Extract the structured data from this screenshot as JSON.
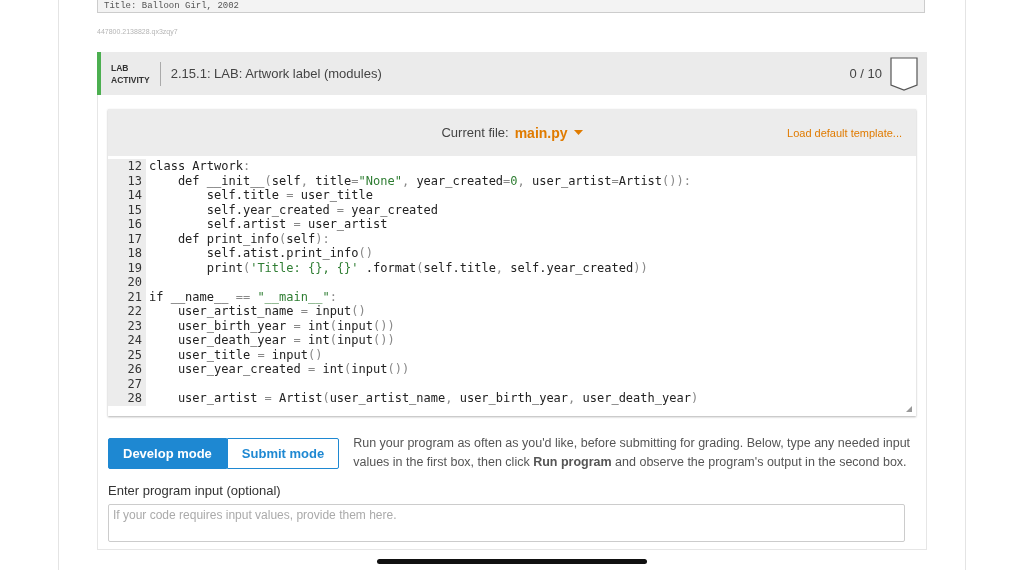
{
  "previous_output": {
    "text": "Title: Balloon Girl, 2002"
  },
  "activity_id": "447800.2138828.qx3zqy7",
  "lab": {
    "badge": [
      "LAB",
      "ACTIVITY"
    ],
    "title": "2.15.1: LAB: Artwork label (modules)",
    "score": "0 / 10"
  },
  "editor": {
    "file_label": "Current file:",
    "file_name": "main.py",
    "template_link": "Load default template...",
    "lines": [
      {
        "number": "12",
        "code": "class Artwork:"
      },
      {
        "number": "13",
        "code": "    def __init__(self, title=\"None\", year_created=0, user_artist=Artist()):"
      },
      {
        "number": "14",
        "code": "        self.title = user_title"
      },
      {
        "number": "15",
        "code": "        self.year_created = year_created"
      },
      {
        "number": "16",
        "code": "        self.artist = user_artist"
      },
      {
        "number": "17",
        "code": "    def print_info(self):"
      },
      {
        "number": "18",
        "code": "        self.atist.print_info()"
      },
      {
        "number": "19",
        "code": "        print('Title: {}, {}' .format(self.title, self.year_created))"
      },
      {
        "number": "20"
      },
      {
        "number": "21",
        "code": "if __name__ == \"__main__\":"
      },
      {
        "number": "22",
        "code": "    user_artist_name = input()"
      },
      {
        "number": "23",
        "code": "    user_birth_year = int(input())"
      },
      {
        "number": "24",
        "code": "    user_death_year = int(input())"
      },
      {
        "number": "25",
        "code": "    user_title = input()"
      },
      {
        "number": "26",
        "code": "    user_year_created = int(input())"
      },
      {
        "number": "27"
      },
      {
        "number": "28",
        "code": "    user_artist = Artist(user_artist_name, user_birth_year, user_death_year)"
      }
    ]
  },
  "modes": [
    {
      "label": "Develop mode",
      "selected": true
    },
    {
      "label": "Submit mode",
      "selected": false
    }
  ],
  "instructions": "Run your program as often as you'd like, before submitting for grading. Below, type any needed input values in the first box, then click **Run program** and observe the program's output in the second box.",
  "input": {
    "label": "Enter program input (optional)",
    "placeholder": "If your code requires input values, provide them here."
  }
}
